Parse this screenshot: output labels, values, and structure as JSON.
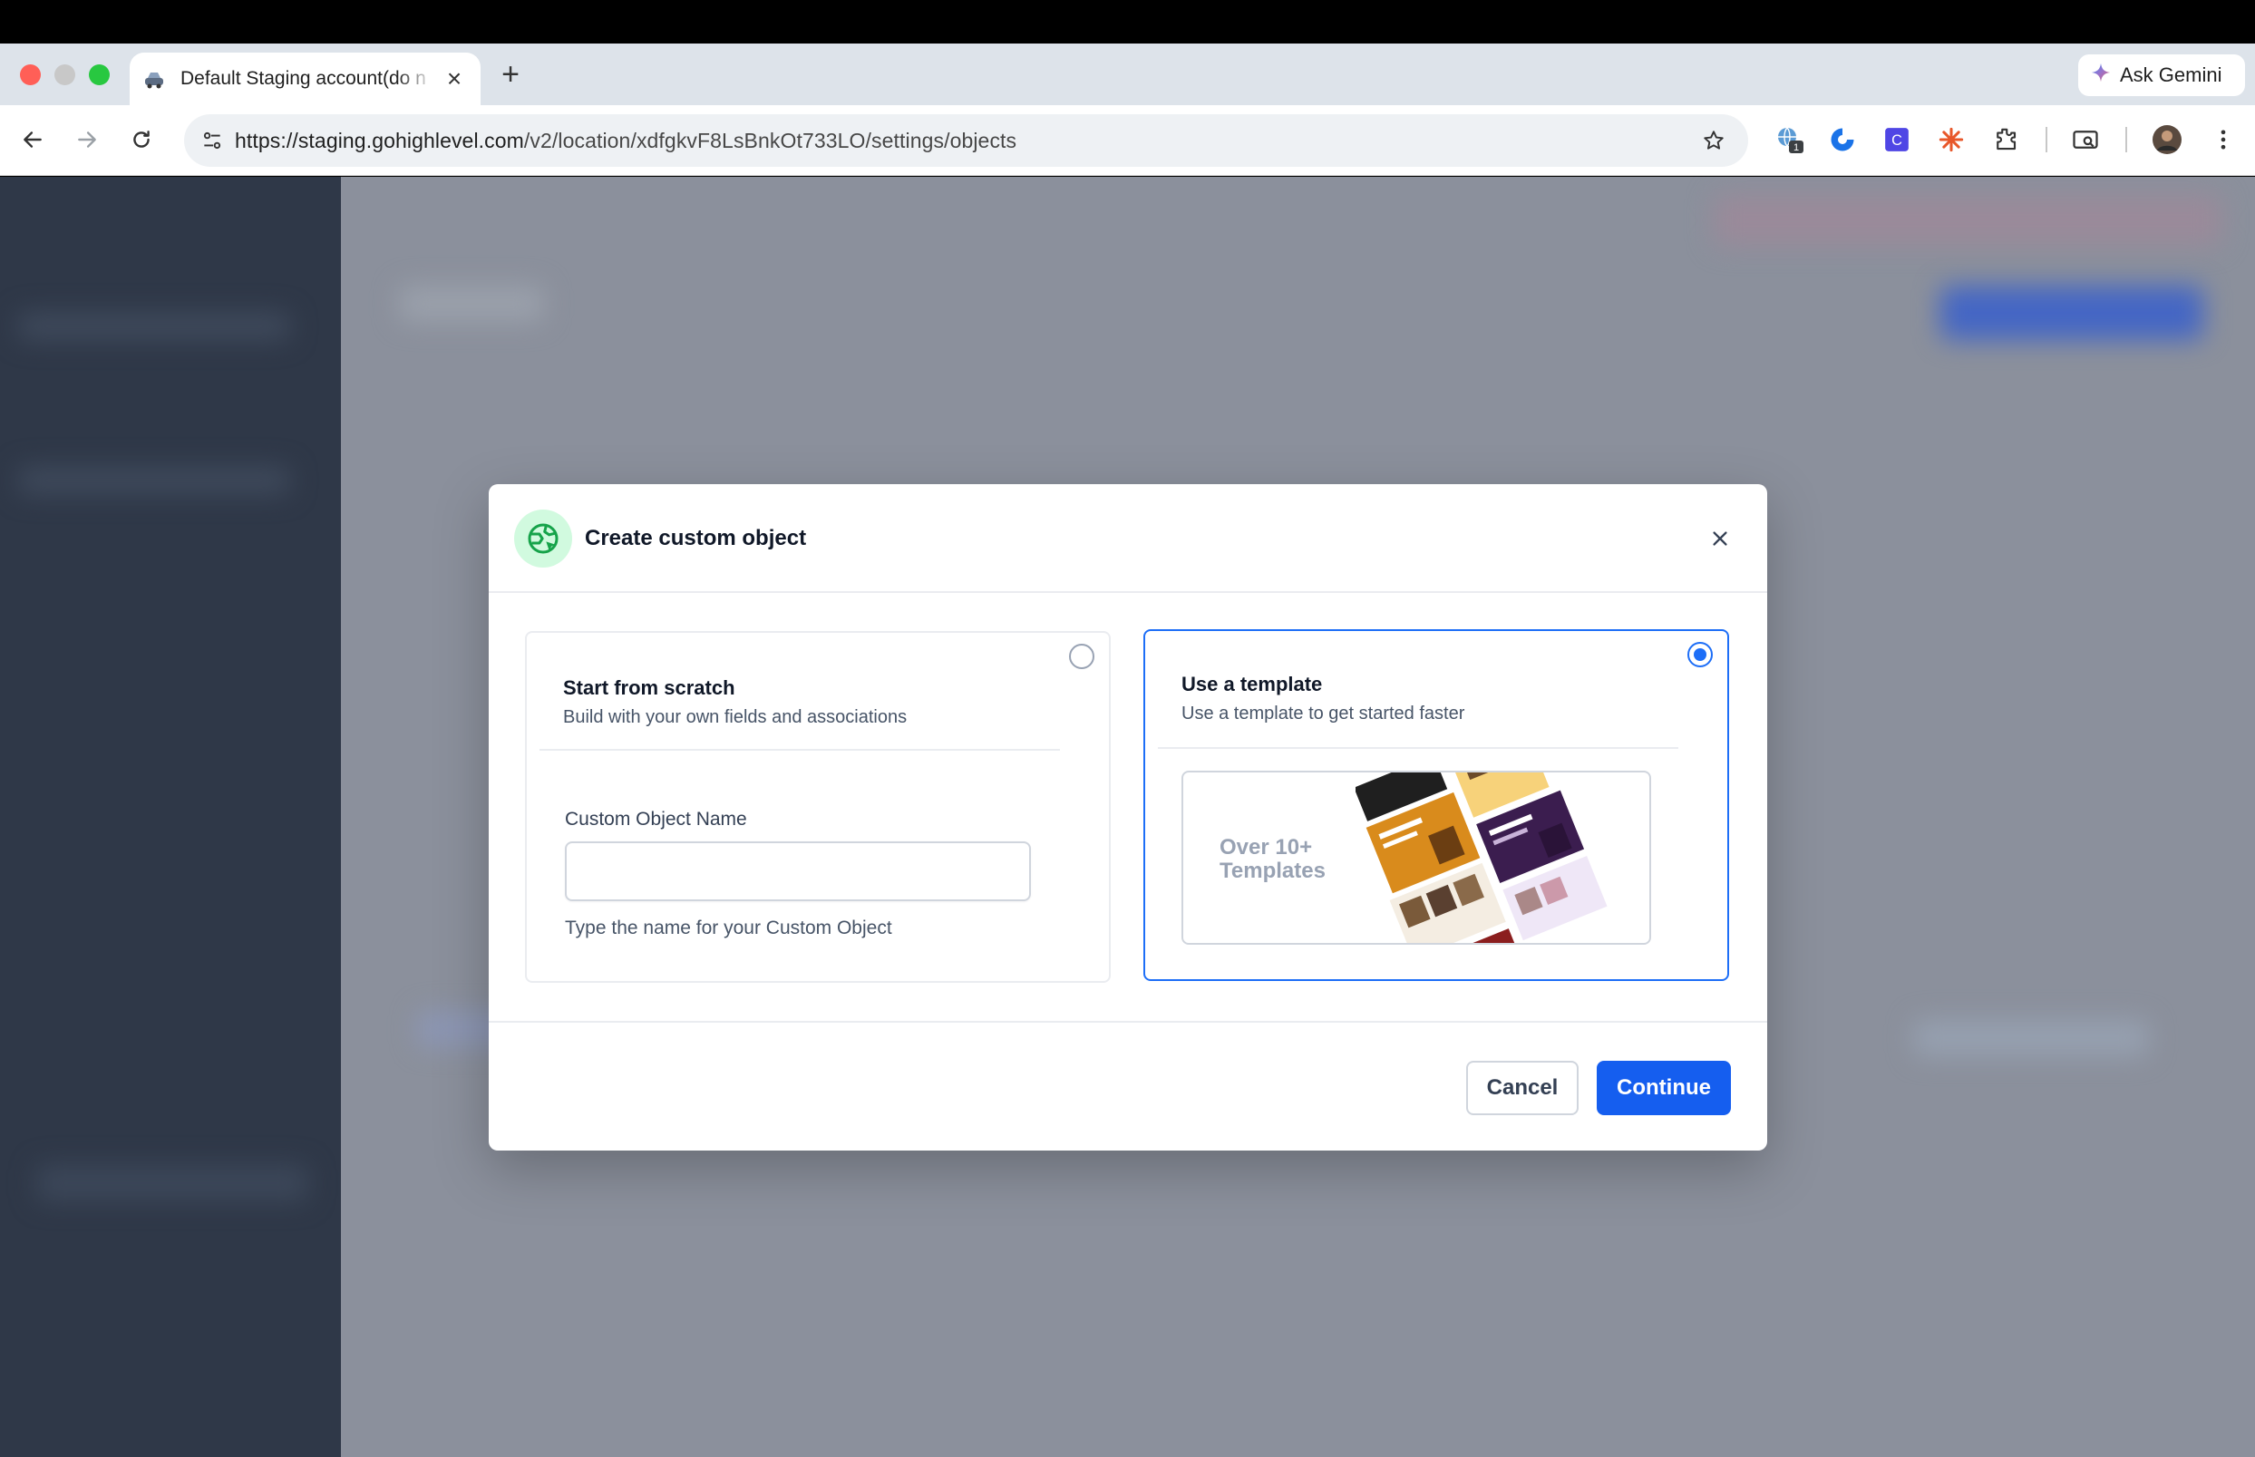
{
  "browser": {
    "tab_title": "Default Staging account(do n",
    "new_tab_symbol": "+",
    "close_symbol": "×",
    "gemini_label": "Ask Gemini",
    "url_domain": "https://staging.gohighlevel.com",
    "url_path": "/v2/location/xdfgkvF8LsBnkOt733LO/settings/objects",
    "extension_badge": "1",
    "extension_letter": "C"
  },
  "modal": {
    "title": "Create custom object",
    "scratch": {
      "title": "Start from scratch",
      "subtitle": "Build with your own fields and associations",
      "field_label": "Custom Object Name",
      "field_value": "",
      "field_hint": "Type the name for your Custom Object",
      "selected": false
    },
    "template": {
      "title": "Use a template",
      "subtitle": "Use a template to get started faster",
      "preview_line1": "Over 10+",
      "preview_line2": "Templates",
      "selected": true
    },
    "cancel_label": "Cancel",
    "continue_label": "Continue"
  },
  "colors": {
    "accent": "#155eef",
    "selected_border": "#1d6ef7",
    "icon_bg": "#d1fadf",
    "icon_fg": "#16a34a"
  }
}
